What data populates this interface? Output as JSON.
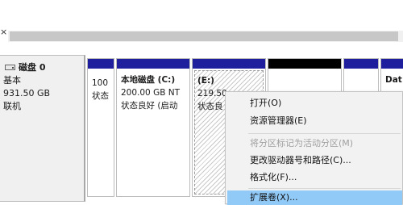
{
  "window": {
    "close_glyph": "×"
  },
  "disk": {
    "icon": "hard-disk-icon",
    "name": "磁盘 0",
    "type": "基本",
    "size": "931.50 GB",
    "status": "联机"
  },
  "partitions": [
    {
      "id": "p1",
      "line1": "",
      "line2": "100",
      "line3": "状态"
    },
    {
      "id": "p2",
      "line1": "本地磁盘  (C:)",
      "line2": "200.00 GB NT",
      "line3": "状态良好 (启动"
    },
    {
      "id": "p3",
      "line1": "(E:)",
      "line2": "219.50",
      "line3": "状态良"
    },
    {
      "id": "p4",
      "line1": "",
      "line2": "",
      "line3": ""
    },
    {
      "id": "p5",
      "line1": "",
      "line2": "",
      "line3": ""
    },
    {
      "id": "p6",
      "line1": "Dat",
      "line2": "",
      "line3": ""
    }
  ],
  "context_menu": {
    "items": [
      {
        "label": "打开(O)",
        "enabled": true
      },
      {
        "label": "资源管理器(E)",
        "enabled": true
      },
      {
        "label": "将分区标记为活动分区(M)",
        "enabled": false
      },
      {
        "label": "更改驱动器号和路径(C)...",
        "enabled": true
      },
      {
        "label": "格式化(F)...",
        "enabled": true
      },
      {
        "label": "扩展卷(X)...",
        "enabled": true,
        "highlighted": true
      }
    ]
  },
  "colors": {
    "primary_partition_header": "#1f1f9e",
    "unallocated_header": "#000000",
    "menu_highlight": "#91c9f7"
  }
}
